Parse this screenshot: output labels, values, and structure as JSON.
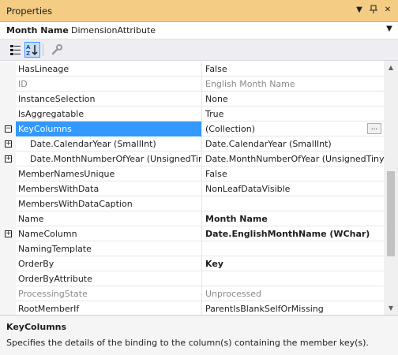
{
  "titlebar": {
    "title": "Properties"
  },
  "object": {
    "name": "Month Name",
    "type": "DimensionAttribute"
  },
  "toolbar": {
    "buttons": [
      {
        "name": "categorized-icon"
      },
      {
        "name": "alphabetical-icon",
        "active": true
      },
      {
        "name": "property-pages-icon"
      }
    ]
  },
  "properties": [
    {
      "name": "HasLineage",
      "value": "False"
    },
    {
      "name": "ID",
      "value": "English Month Name",
      "disabled": true
    },
    {
      "name": "InstanceSelection",
      "value": "None"
    },
    {
      "name": "IsAggregatable",
      "value": "True"
    },
    {
      "name": "KeyColumns",
      "value": "(Collection)",
      "expander": "−",
      "selected": true,
      "ellipsis": "..."
    },
    {
      "name": "Date.CalendarYear (SmallInt)",
      "value": "Date.CalendarYear (SmallInt)",
      "expander": "+",
      "indent": true
    },
    {
      "name": "Date.MonthNumberOfYear (UnsignedTiny",
      "value": "Date.MonthNumberOfYear (UnsignedTiny",
      "expander": "+",
      "indent": true
    },
    {
      "name": "MemberNamesUnique",
      "value": "False"
    },
    {
      "name": "MembersWithData",
      "value": "NonLeafDataVisible"
    },
    {
      "name": "MembersWithDataCaption",
      "value": ""
    },
    {
      "name": "Name",
      "value": "Month Name",
      "bold": true
    },
    {
      "name": "NameColumn",
      "value": "Date.EnglishMonthName (WChar)",
      "expander": "+",
      "bold": true
    },
    {
      "name": "NamingTemplate",
      "value": ""
    },
    {
      "name": "OrderBy",
      "value": "Key",
      "bold": true
    },
    {
      "name": "OrderByAttribute",
      "value": ""
    },
    {
      "name": "ProcessingState",
      "value": "Unprocessed",
      "disabled": true
    },
    {
      "name": "RootMemberIf",
      "value": "ParentIsBlankSelfOrMissing"
    }
  ],
  "description": {
    "title": "KeyColumns",
    "text": "Specifies the details of the binding to the column(s) containing the member key(s)."
  }
}
